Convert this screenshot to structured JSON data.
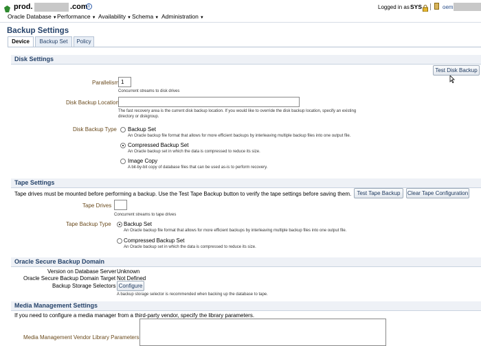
{
  "header": {
    "host_prefix": "prod.",
    "host_suffix": ".com",
    "info_icon": "info-icon",
    "logged_in_text": "Logged in as",
    "user": "SYS",
    "user_suffix": "oem",
    "lock_icon": "lock-icon",
    "target_icon": "target-icon"
  },
  "menu": [
    {
      "label": "Oracle Database"
    },
    {
      "label": "Performance"
    },
    {
      "label": "Availability"
    },
    {
      "label": "Schema"
    },
    {
      "label": "Administration"
    }
  ],
  "page": {
    "title": "Backup Settings",
    "tabs": [
      {
        "label": "Device",
        "active": true
      },
      {
        "label": "Backup Set",
        "active": false
      },
      {
        "label": "Policy",
        "active": false
      }
    ]
  },
  "disk": {
    "section_title": "Disk Settings",
    "test_button": "Test Disk Backup",
    "parallelism_label": "Parallelism",
    "parallelism_value": "1",
    "parallelism_help": "Concurrent streams to disk drives",
    "location_label": "Disk Backup Location",
    "location_value": "",
    "location_help_1": "The fast recovery area is the current disk backup location. If you would like to override the disk backup location, specify an existing",
    "location_help_2": "directory or diskgroup.",
    "type_label": "Disk Backup Type",
    "options": [
      {
        "label": "Backup Set",
        "help": "An Oracle backup file format that allows for more efficient backups by interleaving multiple backup files into one output file.",
        "selected": false
      },
      {
        "label": "Compressed Backup Set",
        "help": "An Oracle backup set in which the data is compressed to reduce its size.",
        "selected": true
      },
      {
        "label": "Image Copy",
        "help": "A bit-by-bit copy of database files that can be used as-is to perform recovery.",
        "selected": false
      }
    ]
  },
  "tape": {
    "section_title": "Tape Settings",
    "intro": "Tape drives must be mounted before performing a backup. Use the Test Tape Backup button to verify the tape settings before saving them.",
    "test_button": "Test Tape Backup",
    "clear_button": "Clear Tape Configuration",
    "drives_label": "Tape Drives",
    "drives_value": "",
    "drives_help": "Concurrent streams to tape drives",
    "type_label": "Tape Backup Type",
    "options": [
      {
        "label": "Backup Set",
        "help": "An Oracle backup file format that allows for more efficient backups by interleaving multiple backup files into one output file.",
        "selected": true
      },
      {
        "label": "Compressed Backup Set",
        "help": "An Oracle backup set in which the data is compressed to reduce its size.",
        "selected": false
      }
    ]
  },
  "osb": {
    "section_title": "Oracle Secure Backup Domain",
    "version_label": "Version on Database Server",
    "version_value": "Unknown",
    "target_label": "Oracle Secure Backup Domain Target",
    "target_value": "Not Defined",
    "selectors_label": "Backup Storage Selectors",
    "configure_button": "Configure",
    "selectors_help": "A backup storage selector is recommended when backing up the database to tape."
  },
  "media": {
    "section_title": "Media Management Settings",
    "intro": "If you need to configure a media manager from a third-party vendor, specify the library parameters.",
    "params_label": "Media Management Vendor Library Parameters",
    "params_value": ""
  }
}
